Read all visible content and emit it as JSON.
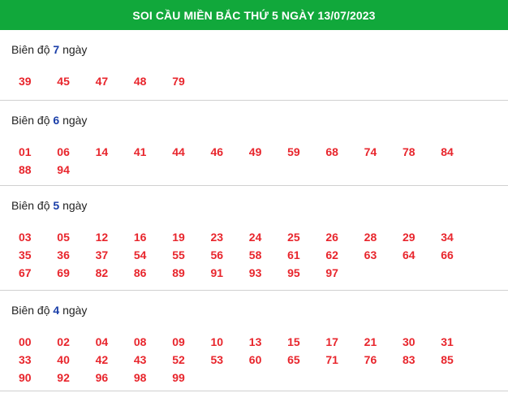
{
  "header": {
    "title": "SOI CẦU MIỀN BẮC THỨ 5 NGÀY 13/07/2023"
  },
  "sections": [
    {
      "prefix": "Biên độ",
      "count": "7",
      "suffix": "ngày",
      "numbers": [
        "39",
        "45",
        "47",
        "48",
        "79"
      ]
    },
    {
      "prefix": "Biên độ",
      "count": "6",
      "suffix": "ngày",
      "numbers": [
        "01",
        "06",
        "14",
        "41",
        "44",
        "46",
        "49",
        "59",
        "68",
        "74",
        "78",
        "84",
        "88",
        "94"
      ]
    },
    {
      "prefix": "Biên độ",
      "count": "5",
      "suffix": "ngày",
      "numbers": [
        "03",
        "05",
        "12",
        "16",
        "19",
        "23",
        "24",
        "25",
        "26",
        "28",
        "29",
        "34",
        "35",
        "36",
        "37",
        "54",
        "55",
        "56",
        "58",
        "61",
        "62",
        "63",
        "64",
        "66",
        "67",
        "69",
        "82",
        "86",
        "89",
        "91",
        "93",
        "95",
        "97"
      ]
    },
    {
      "prefix": "Biên độ",
      "count": "4",
      "suffix": "ngày",
      "numbers": [
        "00",
        "02",
        "04",
        "08",
        "09",
        "10",
        "13",
        "15",
        "17",
        "21",
        "30",
        "31",
        "33",
        "40",
        "42",
        "43",
        "52",
        "53",
        "60",
        "65",
        "71",
        "76",
        "83",
        "85",
        "90",
        "92",
        "96",
        "98",
        "99"
      ]
    }
  ],
  "colors": {
    "header_bg": "#11a83b",
    "number": "#e8252c",
    "count": "#1a3ea8"
  }
}
